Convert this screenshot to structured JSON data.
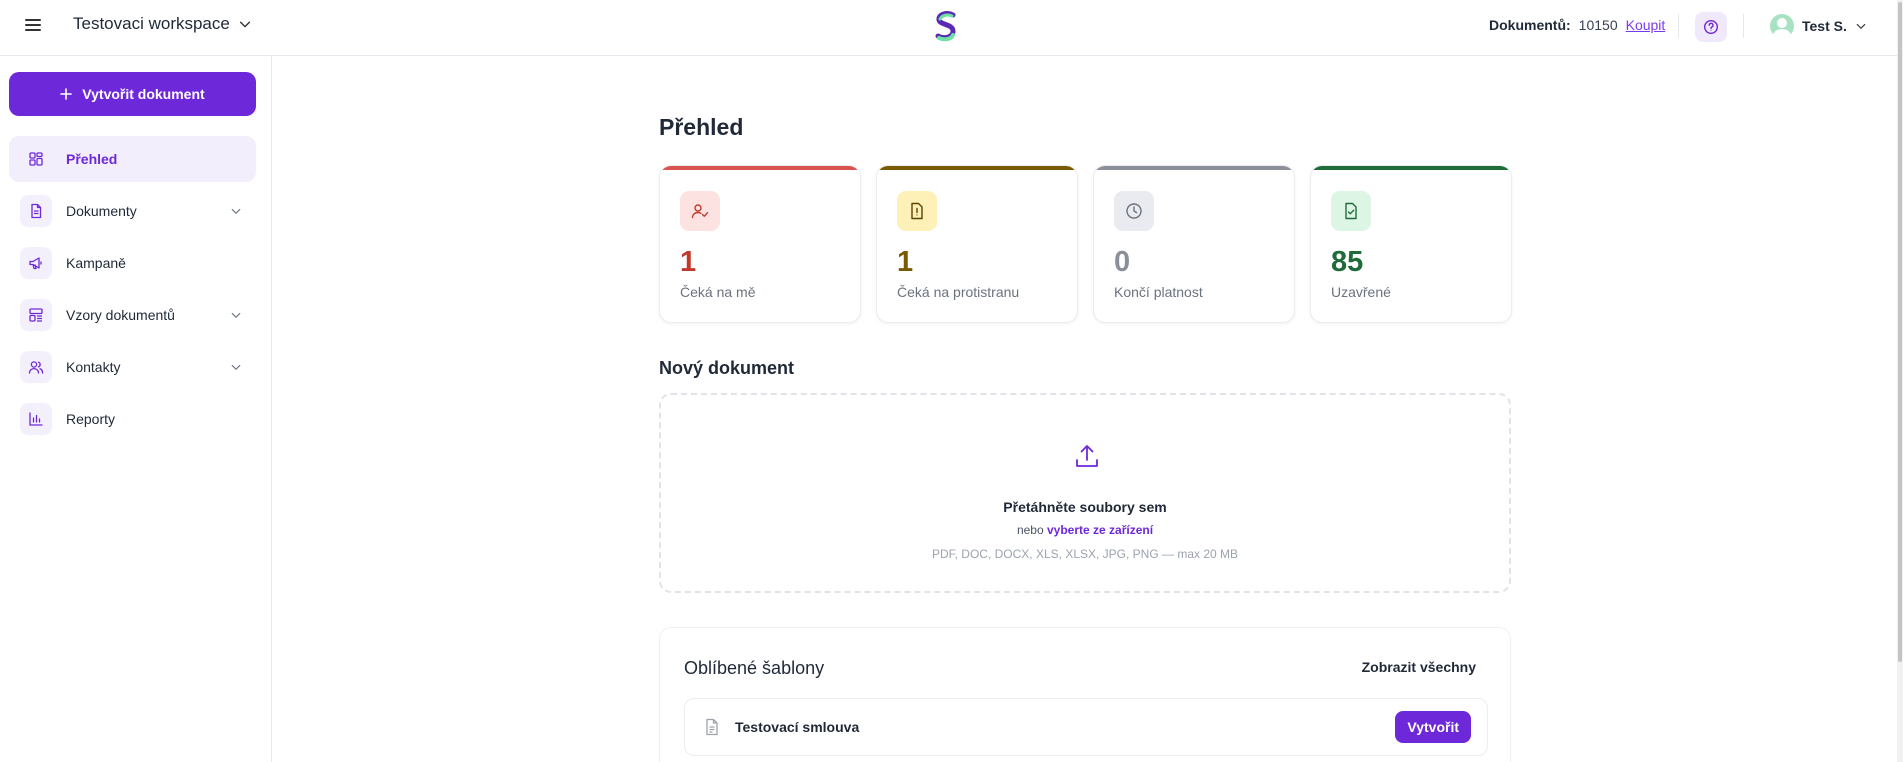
{
  "header": {
    "workspace_name": "Testovaci workspace",
    "documents_label": "Dokumentů:",
    "documents_count": "10150",
    "buy_label": "Koupit",
    "user_name": "Test S."
  },
  "sidebar": {
    "create_label": "Vytvořit dokument",
    "items": [
      {
        "label": "Přehled",
        "icon": "dashboard-icon",
        "active": true,
        "has_chevron": false
      },
      {
        "label": "Dokumenty",
        "icon": "document-icon",
        "active": false,
        "has_chevron": true
      },
      {
        "label": "Kampaně",
        "icon": "megaphone-icon",
        "active": false,
        "has_chevron": false
      },
      {
        "label": "Vzory dokumentů",
        "icon": "template-icon",
        "active": false,
        "has_chevron": true
      },
      {
        "label": "Kontakty",
        "icon": "users-icon",
        "active": false,
        "has_chevron": true
      },
      {
        "label": "Reporty",
        "icon": "bar-chart-icon",
        "active": false,
        "has_chevron": false
      }
    ]
  },
  "main": {
    "title": "Přehled",
    "stats": [
      {
        "value": "1",
        "label": "Čeká na mě",
        "icon": "user-check-icon",
        "accent": "#c0392b",
        "bg": "#fde2e2"
      },
      {
        "value": "1",
        "label": "Čeká na protistranu",
        "icon": "file-alert-icon",
        "accent": "#7a5a00",
        "bg": "#fdf1b8"
      },
      {
        "value": "0",
        "label": "Končí platnost",
        "icon": "clock-icon",
        "accent": "#8a8f98",
        "bg": "#e9ebf1"
      },
      {
        "value": "85",
        "label": "Uzavřené",
        "icon": "file-check-icon",
        "accent": "#1f6b3a",
        "bg": "#dcf5e4"
      }
    ],
    "new_doc": {
      "title": "Nový dokument",
      "drop_title": "Přetáhněte soubory sem",
      "or_label": "nebo",
      "pick_label": "vyberte ze zařízení",
      "hint": "PDF, DOC, DOCX, XLS, XLSX, JPG, PNG — max 20 MB"
    },
    "favorites": {
      "title": "Oblíbené šablony",
      "show_all": "Zobrazit všechny",
      "items": [
        {
          "name": "Testovací smlouva",
          "action": "Vytvořit"
        }
      ]
    }
  },
  "colors": {
    "brand": "#6d28d9",
    "brand_light": "#f3eefc"
  }
}
